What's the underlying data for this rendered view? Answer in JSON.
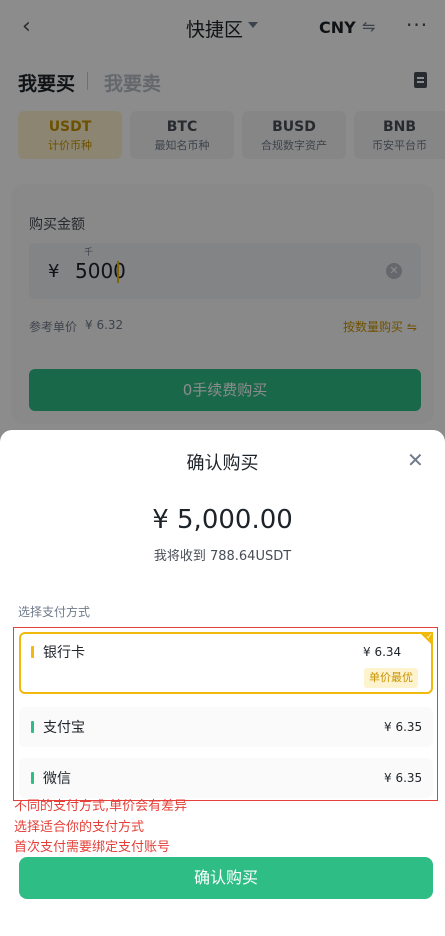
{
  "header": {
    "back_icon": "chevron-left-icon",
    "title": "快捷区",
    "currency": "CNY",
    "swap_icon": "swap-icon",
    "more_icon": "ellipsis-icon"
  },
  "tabs": {
    "buy": "我要买",
    "sell": "我要卖"
  },
  "coins": [
    {
      "symbol": "USDT",
      "desc": "计价币种"
    },
    {
      "symbol": "BTC",
      "desc": "最知名币种"
    },
    {
      "symbol": "BUSD",
      "desc": "合规数字资产"
    },
    {
      "symbol": "BNB",
      "desc": "币安平台币"
    }
  ],
  "buy_form": {
    "amount_label": "购买金额",
    "unit_hint": "千",
    "currency_symbol": "¥",
    "amount": "5000",
    "ref_price_label": "参考单价",
    "ref_price": "¥ 6.32",
    "qty_link": "按数量购买 ⇋",
    "zero_fee_button": "0手续费购买"
  },
  "sheet": {
    "title": "确认购买",
    "total": "¥ 5,000.00",
    "receive_text": "我将收到 788.64USDT",
    "pay_method_label": "选择支付方式",
    "methods": [
      {
        "name": "银行卡",
        "rate": "¥ 6.34",
        "badge": "单价最优"
      },
      {
        "name": "支付宝",
        "rate": "¥ 6.35"
      },
      {
        "name": "微信",
        "rate": "¥ 6.35"
      }
    ],
    "confirm_button": "确认购买"
  },
  "annotations": [
    "不同的支付方式,单价会有差异",
    "选择适合你的支付方式",
    "首次支付需要绑定支付账号"
  ],
  "colors": {
    "accent": "#f0b90b",
    "green": "#2ebd85",
    "annotation_red": "#e5403a"
  }
}
